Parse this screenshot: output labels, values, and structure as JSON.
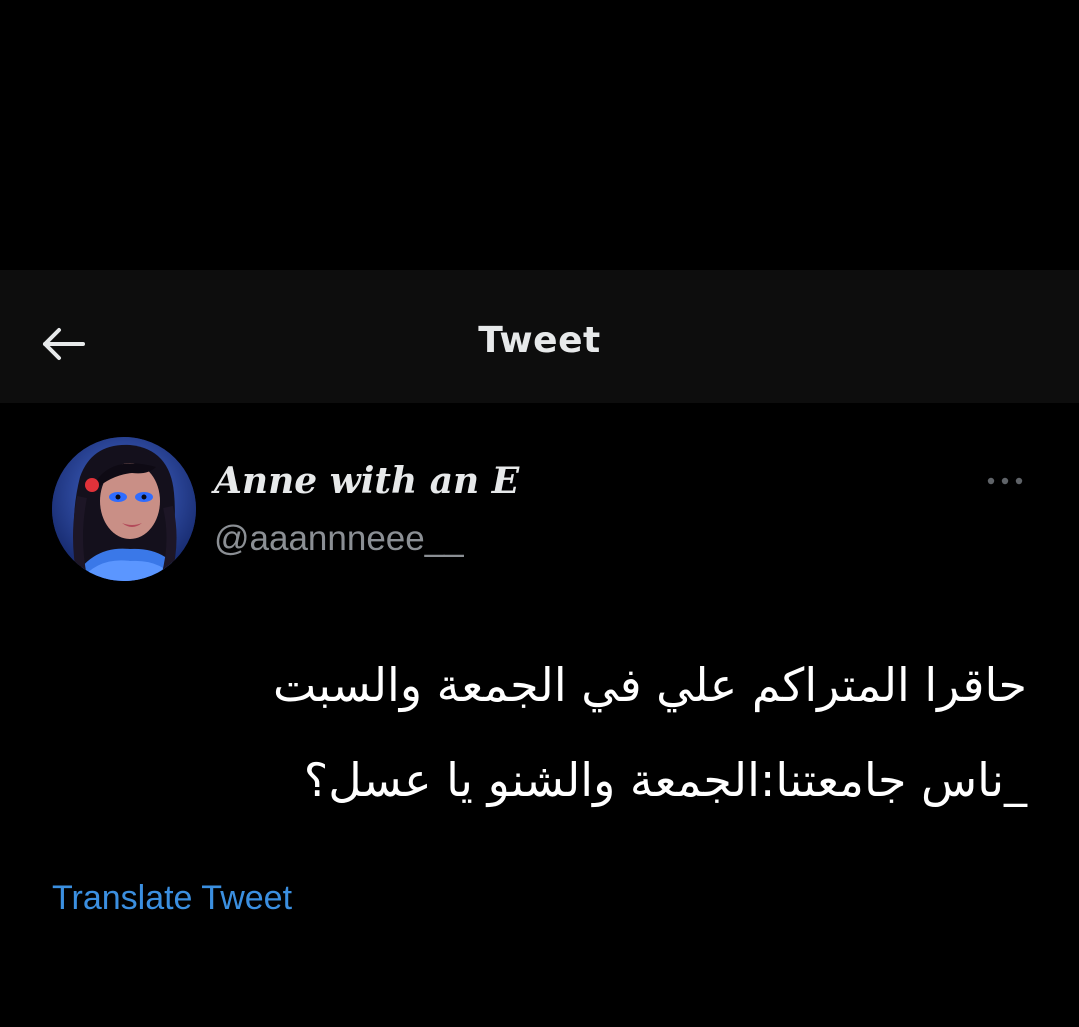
{
  "header": {
    "title": "Tweet",
    "back_icon": "arrow-left-icon"
  },
  "author": {
    "display_name": "Anne with an E",
    "handle": "@aaannneee__",
    "avatar_icon": "avatar-image"
  },
  "more_icon": "more-horizontal-icon",
  "tweet": {
    "lines": [
      "حاقرا المتراكم علي في الجمعة والسبت",
      "_ناس جامعتنا:الجمعة والشنو يا عسل؟"
    ]
  },
  "translate_label": "Translate Tweet",
  "colors": {
    "background": "#000000",
    "header_bar": "#0d0d0d",
    "text_primary": "#e7e9ea",
    "text_secondary": "#8b8f94",
    "link": "#3b8fe0"
  }
}
